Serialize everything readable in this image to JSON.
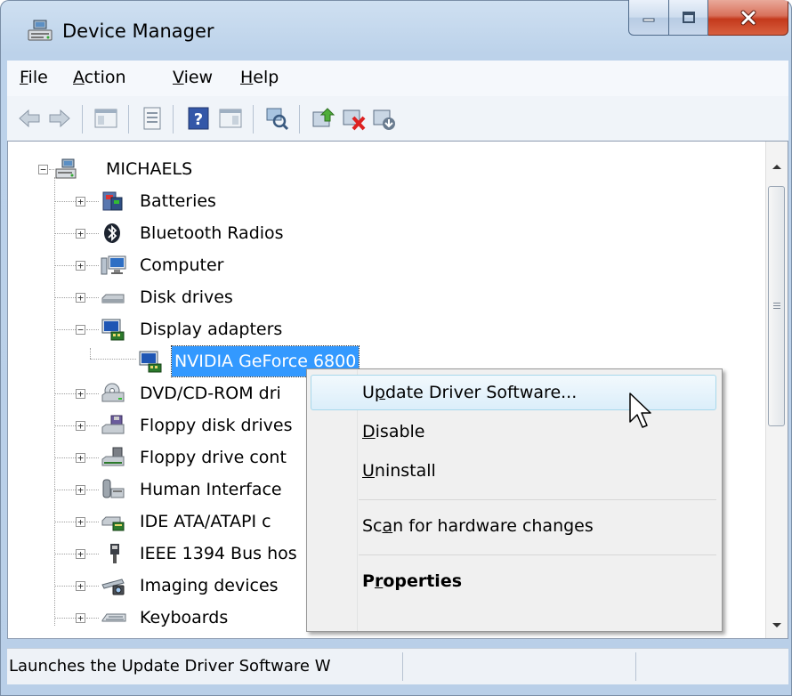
{
  "window": {
    "title": "Device Manager",
    "icons": {
      "app": "device-manager-icon",
      "minimize": "minimize-icon",
      "maximize": "maximize-icon",
      "close": "close-icon"
    }
  },
  "menu": {
    "file": {
      "accel": "F",
      "rest": "ile"
    },
    "action": {
      "accel": "A",
      "rest": "ction"
    },
    "view": {
      "accel": "V",
      "rest": "iew"
    },
    "help": {
      "accel": "H",
      "rest": "elp"
    }
  },
  "toolbar": {
    "icons": [
      "back-icon",
      "forward-icon",
      "show-hide-console-tree-icon",
      "properties-icon",
      "help-icon",
      "action-pane-icon",
      "scan-hardware-icon",
      "update-driver-icon",
      "uninstall-icon",
      "enable-icon"
    ]
  },
  "tree": {
    "root": "MICHAELS",
    "items": [
      {
        "label": "Batteries",
        "icon": "battery-icon"
      },
      {
        "label": "Bluetooth Radios",
        "icon": "bluetooth-icon"
      },
      {
        "label": "Computer",
        "icon": "computer-icon"
      },
      {
        "label": "Disk drives",
        "icon": "disk-drive-icon"
      },
      {
        "label": "Display adapters",
        "icon": "display-adapter-icon"
      },
      {
        "label": "NVIDIA GeForce 6800",
        "icon": "display-adapter-icon"
      },
      {
        "label": "DVD/CD-ROM dri",
        "icon": "dvd-drive-icon"
      },
      {
        "label": "Floppy disk drives",
        "icon": "floppy-drive-icon"
      },
      {
        "label": "Floppy drive cont",
        "icon": "floppy-controller-icon"
      },
      {
        "label": "Human Interface",
        "icon": "hid-icon"
      },
      {
        "label": "IDE ATA/ATAPI c",
        "icon": "ide-controller-icon"
      },
      {
        "label": "IEEE 1394 Bus hos",
        "icon": "ieee1394-icon"
      },
      {
        "label": "Imaging devices",
        "icon": "imaging-device-icon"
      },
      {
        "label": "Keyboards",
        "icon": "keyboard-icon"
      }
    ]
  },
  "context_menu": {
    "update": {
      "pre": "U",
      "accel": "p",
      "post": "date Driver Software..."
    },
    "disable": {
      "accel": "D",
      "rest": "isable"
    },
    "uninstall": {
      "accel": "U",
      "rest": "ninstall"
    },
    "scan": {
      "pre": "Sc",
      "accel": "a",
      "post": "n for hardware changes"
    },
    "properties": {
      "pre": "P",
      "accel": "r",
      "post": "operties"
    }
  },
  "status": {
    "text": "Launches the Update Driver Software W"
  },
  "colors": {
    "selection": "#3399ff",
    "title_bar": "#bcd2ea",
    "close_button": "#c4391c"
  }
}
